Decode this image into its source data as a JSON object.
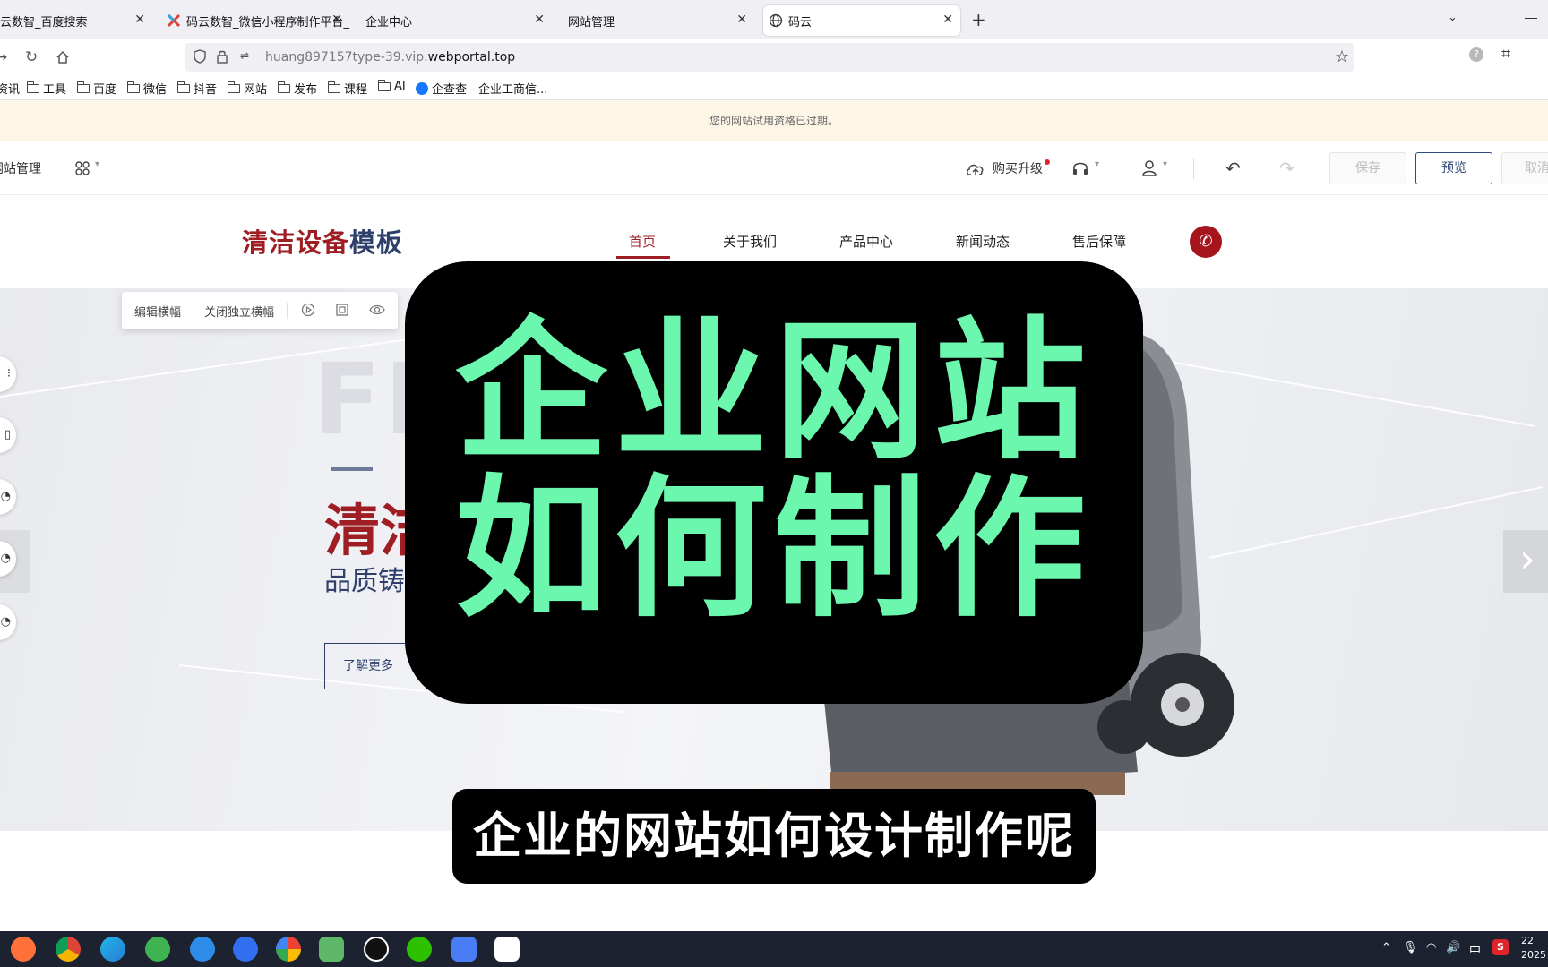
{
  "browser": {
    "tabs": [
      {
        "title": "云数智_百度搜索",
        "active": false
      },
      {
        "title": "码云数智_微信小程序制作平台_",
        "active": false
      },
      {
        "title": "企业中心",
        "active": false
      },
      {
        "title": "网站管理",
        "active": false
      },
      {
        "title": "码云",
        "active": true
      }
    ],
    "url_prefix": "huang897157type-39.vip.",
    "url_domain": "webportal.top",
    "bookmarks": [
      "资讯",
      "工具",
      "百度",
      "微信",
      "抖音",
      "网站",
      "发布",
      "课程",
      "AI",
      "企查查 - 企业工商信..."
    ],
    "ext_badge": "?"
  },
  "notice": "您的网站试用资格已过期。",
  "editor": {
    "site_manage": "网站管理",
    "buy_upgrade": "购买升级",
    "save": "保存",
    "preview": "预览",
    "cancel": "取消"
  },
  "site": {
    "logo_red": "清洁设备",
    "logo_blue": "模板",
    "nav": [
      "首页",
      "关于我们",
      "产品中心",
      "新闻动态",
      "售后保障"
    ],
    "active_nav": "首页",
    "ghost_text": "FL",
    "hero_title": "清洁",
    "hero_subtitle": "品质铸",
    "more_button": "了解更多"
  },
  "float_toolbar": {
    "edit_banner": "编辑横幅",
    "close_independent": "关闭独立横幅"
  },
  "overlay": {
    "line1": "企业网站",
    "line2": "如何制作",
    "caption": "企业的网站如何设计制作呢"
  },
  "taskbar": {
    "ime": "中",
    "time": "22",
    "date": "2025"
  },
  "colors": {
    "brand_red": "#9e1e23",
    "brand_blue": "#2f3f6b",
    "overlay_green": "#6cf7ae",
    "notice_bg": "#fdf5e6"
  }
}
